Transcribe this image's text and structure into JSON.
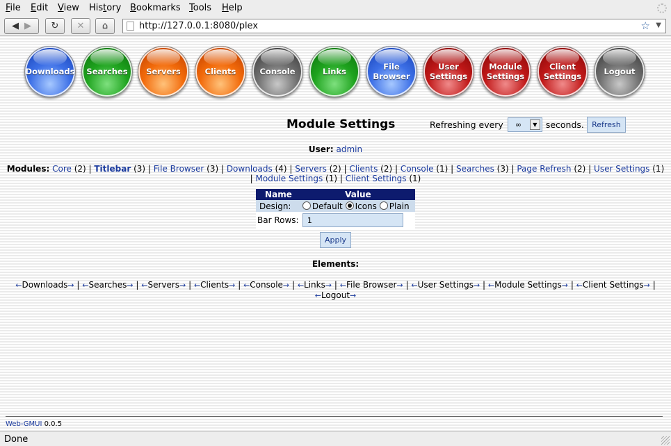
{
  "browser": {
    "menu": [
      {
        "label": "File",
        "name": "menu-file"
      },
      {
        "label": "Edit",
        "name": "menu-edit"
      },
      {
        "label": "View",
        "name": "menu-view"
      },
      {
        "label": "History",
        "name": "menu-history"
      },
      {
        "label": "Bookmarks",
        "name": "menu-bookmarks"
      },
      {
        "label": "Tools",
        "name": "menu-tools"
      },
      {
        "label": "Help",
        "name": "menu-help"
      }
    ],
    "url": "http://127.0.0.1:8080/plex",
    "status": "Done"
  },
  "nav_buttons": [
    {
      "label": "Downloads",
      "color": "#3c6fe6"
    },
    {
      "label": "Searches",
      "color": "#1ea31e"
    },
    {
      "label": "Servers",
      "color": "#f26a0a"
    },
    {
      "label": "Clients",
      "color": "#f26a0a"
    },
    {
      "label": "Console",
      "color": "#6e6e6e"
    },
    {
      "label": "Links",
      "color": "#1ea31e"
    },
    {
      "label": "File Browser",
      "color": "#3c6fe6"
    },
    {
      "label": "User Settings",
      "color": "#c01818"
    },
    {
      "label": "Module Settings",
      "color": "#c01818"
    },
    {
      "label": "Client Settings",
      "color": "#c01818"
    },
    {
      "label": "Logout",
      "color": "#6e6e6e"
    }
  ],
  "page": {
    "title": "Module Settings",
    "refresh": {
      "prefix": "Refreshing every",
      "value": "∞",
      "suffix": "seconds.",
      "button": "Refresh"
    },
    "user_label": "User:",
    "user_name": "admin"
  },
  "modules": {
    "label": "Modules:",
    "items": [
      {
        "name": "Core",
        "count": "(2)"
      },
      {
        "name": "Titlebar",
        "count": "(3)"
      },
      {
        "name": "File Browser",
        "count": "(3)"
      },
      {
        "name": "Downloads",
        "count": "(4)"
      },
      {
        "name": "Servers",
        "count": "(2)"
      },
      {
        "name": "Clients",
        "count": "(2)"
      },
      {
        "name": "Console",
        "count": "(1)"
      },
      {
        "name": "Searches",
        "count": "(3)"
      },
      {
        "name": "Page Refresh",
        "count": "(2)"
      },
      {
        "name": "User Settings",
        "count": "(1)"
      },
      {
        "name": "Module Settings",
        "count": "(1)"
      },
      {
        "name": "Client Settings",
        "count": "(1)"
      }
    ]
  },
  "settings": {
    "col_name": "Name",
    "col_value": "Value",
    "design_label": "Design:",
    "design_options": [
      "Default",
      "Icons",
      "Plain"
    ],
    "design_selected": "Icons",
    "bar_rows_label": "Bar Rows:",
    "bar_rows_value": "1",
    "apply": "Apply"
  },
  "elements": {
    "title": "Elements:",
    "items": [
      "Downloads",
      "Searches",
      "Servers",
      "Clients",
      "Console",
      "Links",
      "File Browser",
      "User Settings",
      "Module Settings",
      "Client Settings",
      "Logout"
    ]
  },
  "footer": {
    "app": "Web-GMUI",
    "version": "0.0.5"
  }
}
